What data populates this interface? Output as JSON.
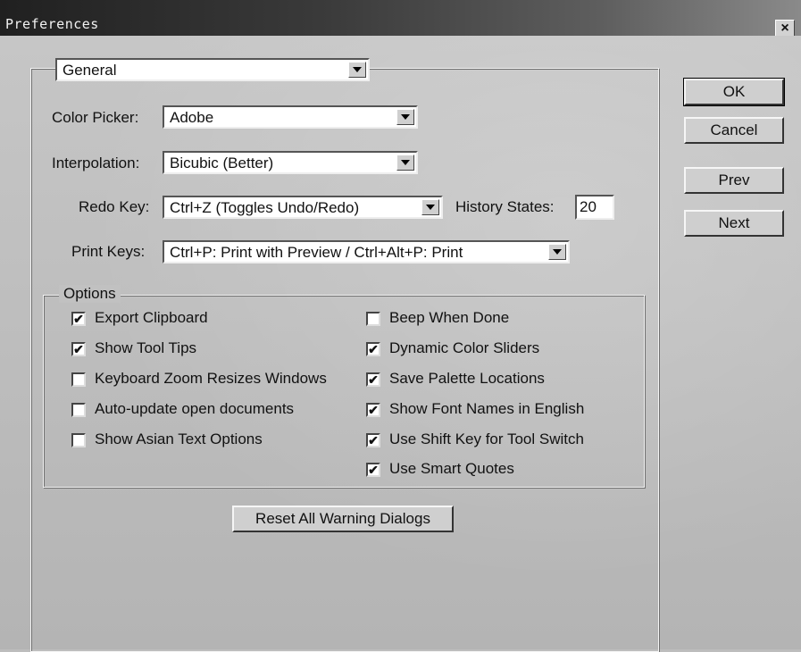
{
  "window": {
    "title": "Preferences",
    "close_symbol": "×"
  },
  "section": {
    "selected": "General"
  },
  "fields": {
    "color_picker": {
      "label": "Color Picker:",
      "value": "Adobe"
    },
    "interpolation": {
      "label": "Interpolation:",
      "value": "Bicubic (Better)"
    },
    "redo_key": {
      "label": "Redo Key:",
      "value": "Ctrl+Z (Toggles Undo/Redo)"
    },
    "history_states": {
      "label": "History States:",
      "value": "20"
    },
    "print_keys": {
      "label": "Print Keys:",
      "value": "Ctrl+P: Print with Preview / Ctrl+Alt+P: Print"
    }
  },
  "options": {
    "legend": "Options",
    "left": [
      {
        "label": "Export Clipboard",
        "checked": true
      },
      {
        "label": "Show Tool Tips",
        "checked": true
      },
      {
        "label": "Keyboard Zoom Resizes Windows",
        "checked": false
      },
      {
        "label": "Auto-update open documents",
        "checked": false
      },
      {
        "label": "Show Asian Text Options",
        "checked": false
      }
    ],
    "right": [
      {
        "label": "Beep When Done",
        "checked": false
      },
      {
        "label": "Dynamic Color Sliders",
        "checked": true
      },
      {
        "label": "Save Palette Locations",
        "checked": true
      },
      {
        "label": "Show Font Names in English",
        "checked": true
      },
      {
        "label": "Use Shift Key for Tool Switch",
        "checked": true
      },
      {
        "label": "Use Smart Quotes",
        "checked": true
      }
    ],
    "check_mark": "✔"
  },
  "buttons": {
    "ok": "OK",
    "cancel": "Cancel",
    "prev": "Prev",
    "next": "Next",
    "reset": "Reset All Warning Dialogs"
  },
  "icons": {
    "close": "close-icon",
    "dropdown": "chevron-down-icon",
    "checkbox": "checkmark-icon"
  }
}
